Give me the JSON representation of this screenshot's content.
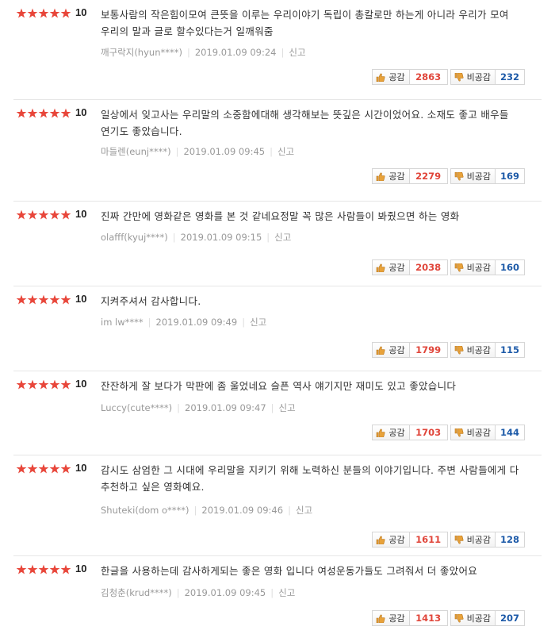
{
  "labels": {
    "like": "공감",
    "dislike": "비공감",
    "report": "신고"
  },
  "colors": {
    "star": "#e8463a",
    "like_count": "#e0453a",
    "dislike_count": "#1d5aa8"
  },
  "reviews": [
    {
      "rating": "10",
      "text": "보통사람의 작은힘이모여 큰뜻을 이루는 우리이야기 독립이 총칼로만 하는게 아니라 우리가 모여 우리의 말과 글로 할수있다는거 일깨워줌",
      "author": "깨구락지(hyun****)",
      "date": "2019.01.09 09:24",
      "likes": "2863",
      "dislikes": "232"
    },
    {
      "rating": "10",
      "text": "일상에서 잊고사는 우리말의 소중함에대해 생각해보는 뜻깊은 시간이었어요. 소재도 좋고 배우들 연기도 좋았습니다.",
      "author": "마들렌(eunj****)",
      "date": "2019.01.09 09:45",
      "likes": "2279",
      "dislikes": "169"
    },
    {
      "rating": "10",
      "text": "진짜 간만에 영화같은 영화를 본 것 같네요정말 꼭 많은 사람들이 봐줬으면 하는 영화",
      "author": "olafff(kyuj****)",
      "date": "2019.01.09 09:15",
      "likes": "2038",
      "dislikes": "160"
    },
    {
      "rating": "10",
      "text": "지켜주셔서 감사합니다.",
      "author": "im lw****",
      "date": "2019.01.09 09:49",
      "likes": "1799",
      "dislikes": "115"
    },
    {
      "rating": "10",
      "text": "잔잔하게 잘 보다가 막판에 좀 울었네요 슬픈 역사 얘기지만 재미도 있고 좋았습니다",
      "author": "Luccy(cute****)",
      "date": "2019.01.09 09:47",
      "likes": "1703",
      "dislikes": "144"
    },
    {
      "rating": "10",
      "text": "감시도 삼엄한 그 시대에 우리말을 지키기 위해 노력하신 분들의 이야기입니다. 주변 사람들에게 다 추천하고 싶은 영화예요.",
      "author": "Shuteki(dom o****)",
      "date": "2019.01.09 09:46",
      "likes": "1611",
      "dislikes": "128"
    },
    {
      "rating": "10",
      "text": "한글을 사용하는데 감사하게되는 좋은 영화 입니다 여성운동가들도 그려줘서 더 좋았어요",
      "author": "김청춘(krud****)",
      "date": "2019.01.09 09:45",
      "likes": "1413",
      "dislikes": "207"
    }
  ]
}
